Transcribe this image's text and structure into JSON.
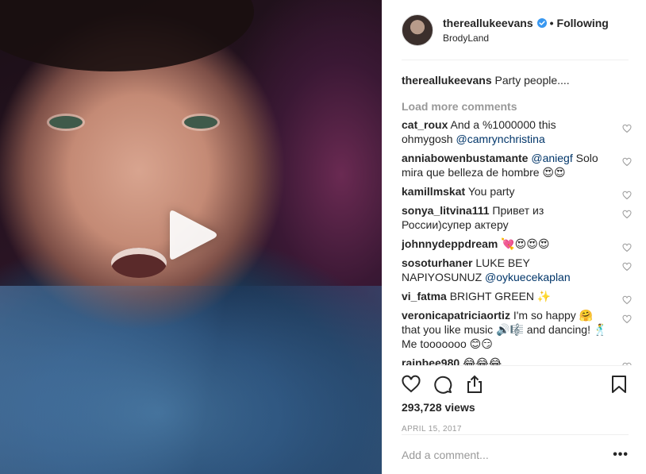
{
  "header": {
    "username": "thereallukeevans",
    "separator": "•",
    "follow_status": "Following",
    "location": "BrodyLand"
  },
  "caption": {
    "username": "thereallukeevans",
    "text": "Party people...."
  },
  "load_more_label": "Load more comments",
  "comments": [
    {
      "username": "cat_roux",
      "text": "And a %1000000 this ohmygosh ",
      "mention": "@camrynchristina",
      "after": ""
    },
    {
      "username": "anniabowenbustamante",
      "text": "",
      "mention": "@aniegf",
      "after": " Solo mira que belleza de hombre 😍😍"
    },
    {
      "username": "kamillmskat",
      "text": "You party",
      "mention": "",
      "after": ""
    },
    {
      "username": "sonya_litvina111",
      "text": "Привет из России)супер актеру",
      "mention": "",
      "after": ""
    },
    {
      "username": "johnnydeppdream",
      "text": "💘😍😍😍",
      "mention": "",
      "after": ""
    },
    {
      "username": "sosoturhaner",
      "text": "LUKE BEY NAPIYOSUNUZ ",
      "mention": "@oykuecekaplan",
      "after": ""
    },
    {
      "username": "vi_fatma",
      "text": "BRIGHT GREEN ✨",
      "mention": "",
      "after": ""
    },
    {
      "username": "veronicapatriciaortiz",
      "text": "I'm so happy 🤗 that you like music 🔊🎼 and dancing! 🕺 Me tooooooo 😊😏",
      "mention": "",
      "after": ""
    },
    {
      "username": "rainbee980",
      "text": "😂😂😂",
      "mention": "",
      "after": ""
    }
  ],
  "stats": {
    "views": "293,728 views",
    "date": "APRIL 15, 2017"
  },
  "add_comment": {
    "placeholder": "Add a comment...",
    "more_label": "•••"
  },
  "colors": {
    "verified_badge": "#3897f0",
    "mention": "#003569",
    "muted": "#999999"
  }
}
